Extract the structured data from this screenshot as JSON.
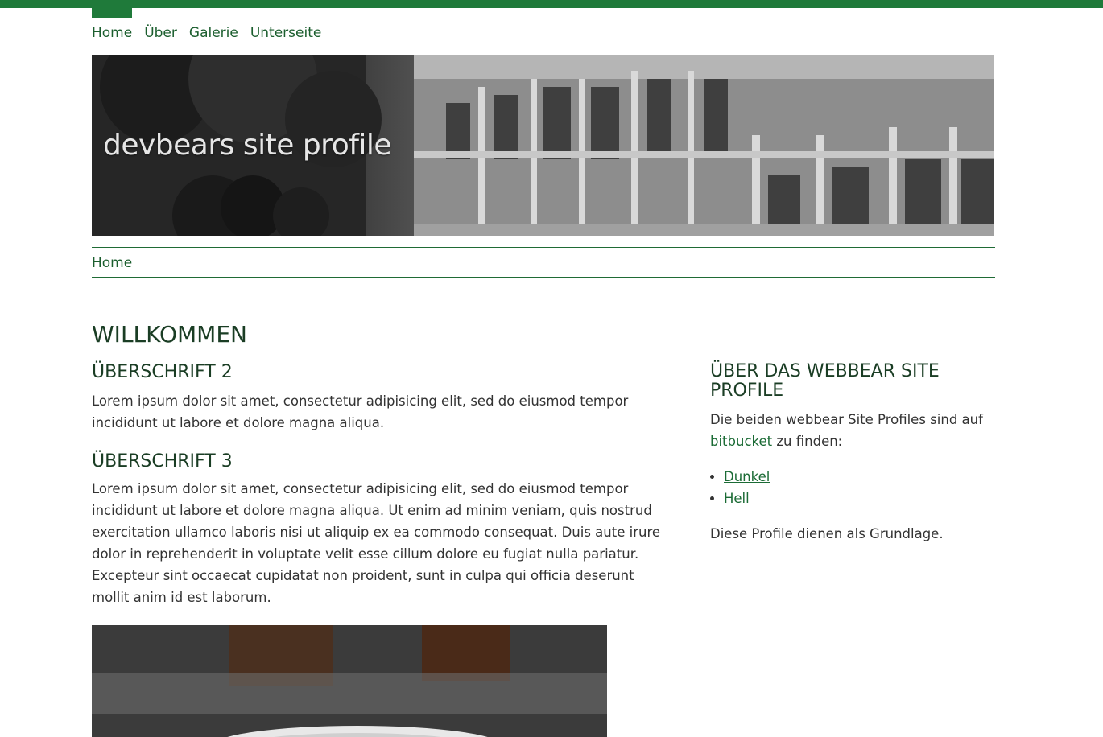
{
  "nav": {
    "items": [
      "Home",
      "Über",
      "Galerie",
      "Unterseite"
    ]
  },
  "hero": {
    "title": "devbears site profile"
  },
  "breadcrumb": {
    "home": "Home"
  },
  "page": {
    "title": "WILLKOMMEN"
  },
  "main": {
    "h2": "ÜBERSCHRIFT 2",
    "p1": "Lorem ipsum dolor sit amet, consectetur adipisicing elit, sed do eiusmod tempor incididunt ut labore et dolore magna aliqua.",
    "h3": "ÜBERSCHRIFT 3",
    "p2": "Lorem ipsum dolor sit amet, consectetur adipisicing elit, sed do eiusmod tempor incididunt ut labore et dolore magna aliqua. Ut enim ad minim veniam, quis nostrud exercitation ullamco laboris nisi ut aliquip ex ea commodo consequat. Duis aute irure dolor in reprehenderit in voluptate velit esse cillum dolore eu fugiat nulla pariatur. Excepteur sint occaecat cupidatat non proident, sunt in culpa qui officia deserunt mollit anim id est laborum."
  },
  "sidebar": {
    "title": "ÜBER DAS WEBBEAR SITE PROFILE",
    "intro_text": "Die beiden webbear Site Profiles sind auf",
    "intro_link": "bitbucket",
    "intro_suffix": "zu finden:",
    "links": [
      "Dunkel",
      "Hell"
    ],
    "footer_text": "Diese Profile dienen als Grundlage."
  },
  "colors": {
    "accent": "#1f7a3a",
    "link": "#1b5e2e",
    "heading": "#1a3d24"
  }
}
